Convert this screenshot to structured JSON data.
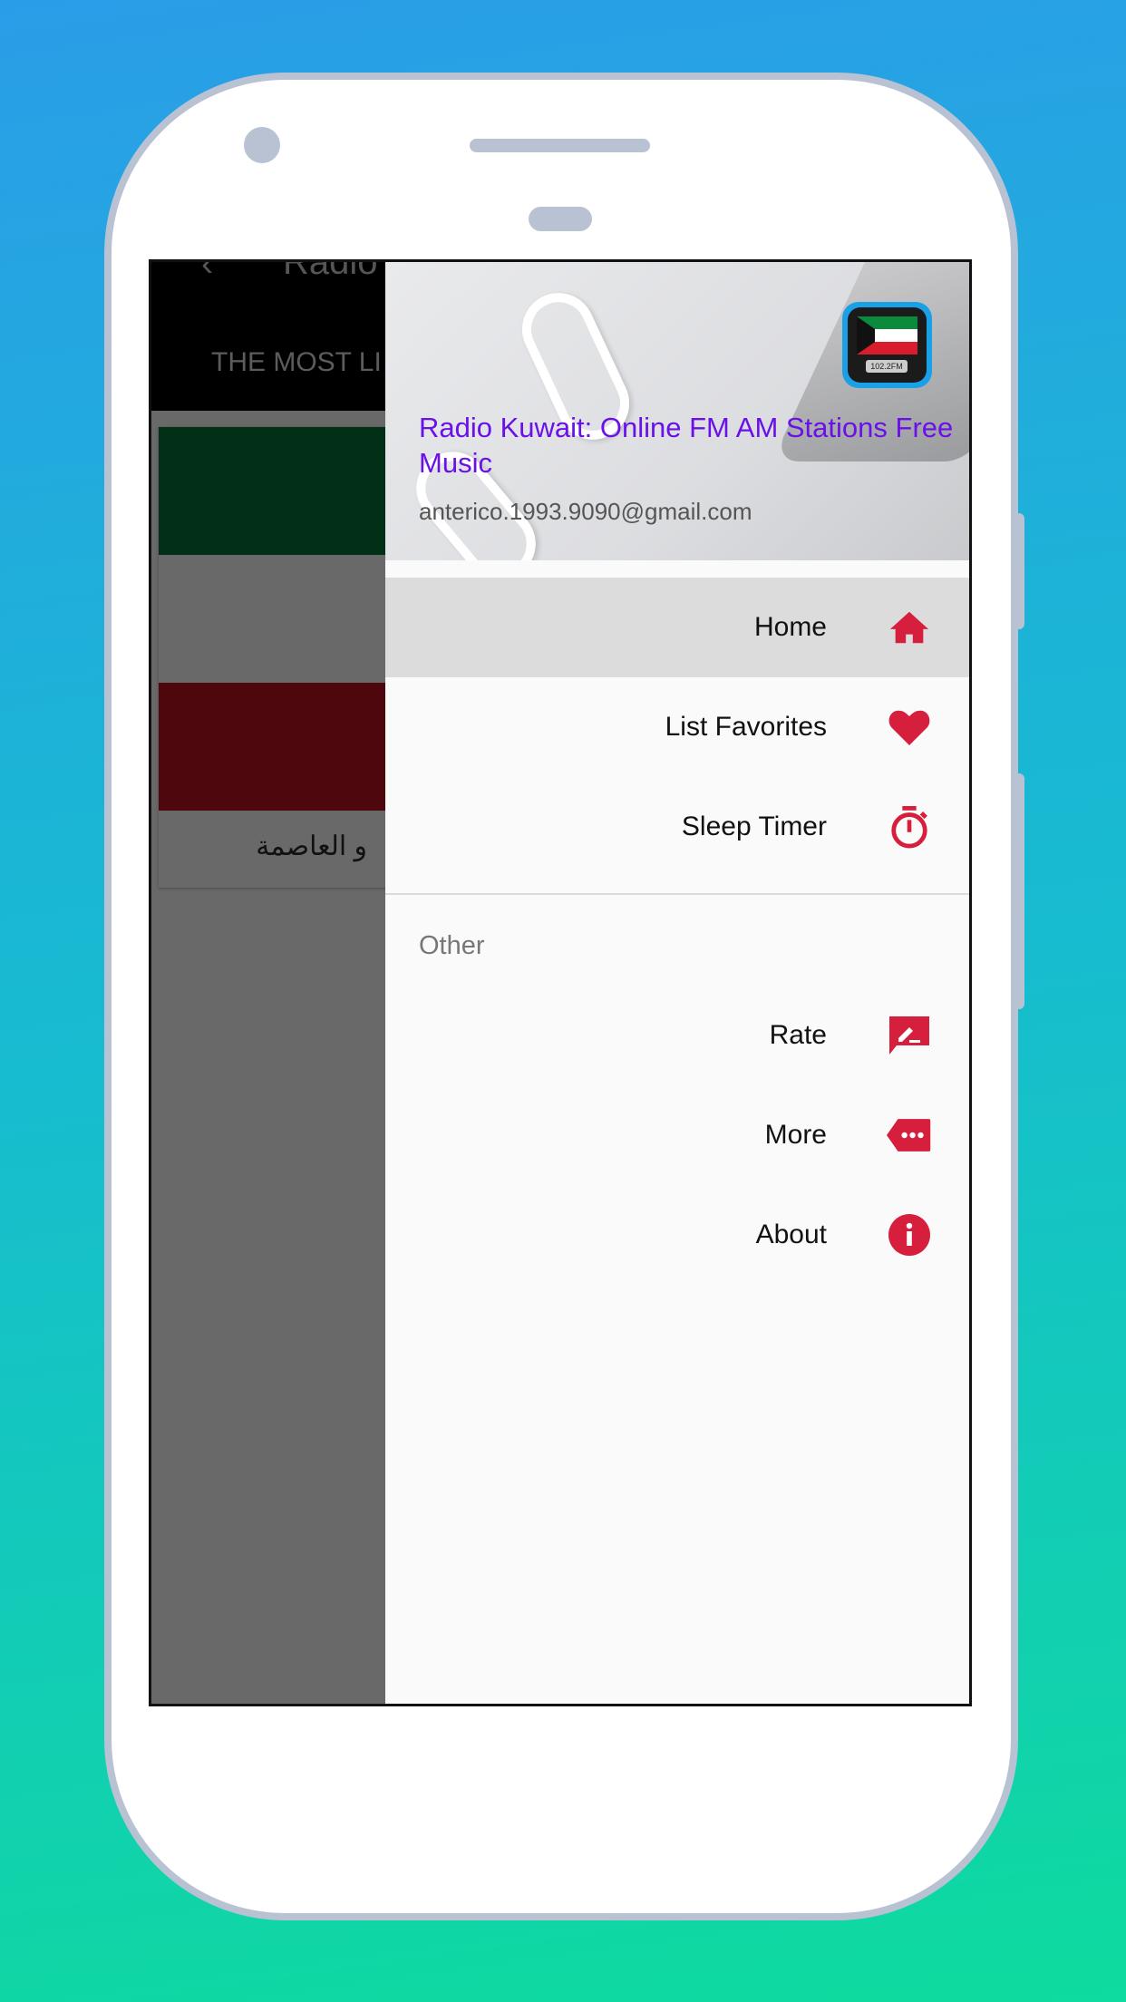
{
  "background_app": {
    "title": "Radio",
    "tab": "THE MOST LI",
    "card_text": "و العاصمة",
    "flag_colors": [
      "#023017",
      "#696969",
      "#4e070d"
    ]
  },
  "drawer": {
    "header": {
      "title": "Radio Kuwait: Online FM AM Stations Free Music",
      "email": "anterico.1993.9090@gmail.com",
      "app_icon_label": "102.2FM"
    },
    "items": [
      {
        "label": "Home",
        "icon": "home-icon",
        "selected": true
      },
      {
        "label": "List Favorites",
        "icon": "heart-icon"
      },
      {
        "label": "Sleep Timer",
        "icon": "stopwatch-icon"
      }
    ],
    "section_label": "Other",
    "other_items": [
      {
        "label": "Rate",
        "icon": "rate-icon"
      },
      {
        "label": "More",
        "icon": "more-icon"
      },
      {
        "label": "About",
        "icon": "info-icon"
      }
    ]
  },
  "colors": {
    "accent": "#d61f3c",
    "title": "#6a10e8"
  }
}
